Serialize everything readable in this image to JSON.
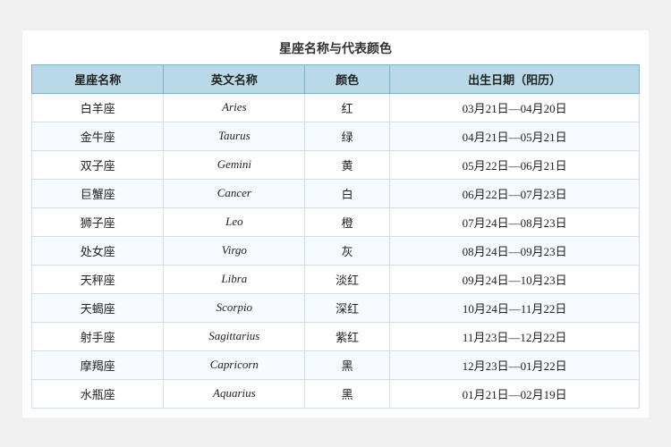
{
  "title": "星座名称与代表颜色",
  "headers": [
    "星座名称",
    "英文名称",
    "颜色",
    "出生日期（阳历）"
  ],
  "rows": [
    {
      "chinese": "白羊座",
      "english": "Aries",
      "color": "红",
      "date": "03月21日—04月20日"
    },
    {
      "chinese": "金牛座",
      "english": "Taurus",
      "color": "绿",
      "date": "04月21日—05月21日"
    },
    {
      "chinese": "双子座",
      "english": "Gemini",
      "color": "黄",
      "date": "05月22日—06月21日"
    },
    {
      "chinese": "巨蟹座",
      "english": "Cancer",
      "color": "白",
      "date": "06月22日—07月23日"
    },
    {
      "chinese": "狮子座",
      "english": "Leo",
      "color": "橙",
      "date": "07月24日—08月23日"
    },
    {
      "chinese": "处女座",
      "english": "Virgo",
      "color": "灰",
      "date": "08月24日—09月23日"
    },
    {
      "chinese": "天秤座",
      "english": "Libra",
      "color": "淡红",
      "date": "09月24日—10月23日"
    },
    {
      "chinese": "天蝎座",
      "english": "Scorpio",
      "color": "深红",
      "date": "10月24日—11月22日"
    },
    {
      "chinese": "射手座",
      "english": "Sagittarius",
      "color": "紫红",
      "date": "11月23日—12月22日"
    },
    {
      "chinese": "摩羯座",
      "english": "Capricorn",
      "color": "黑",
      "date": "12月23日—01月22日"
    },
    {
      "chinese": "水瓶座",
      "english": "Aquarius",
      "color": "黑",
      "date": "01月21日—02月19日"
    }
  ]
}
